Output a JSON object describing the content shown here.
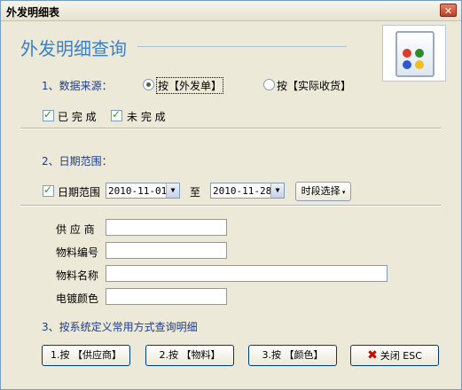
{
  "window": {
    "title": "外发明细表",
    "close_label": "✕"
  },
  "heading": "外发明细查询",
  "logo": {
    "icon": "four-color-squares-icon",
    "colors": [
      "#e23a2a",
      "#2d8a2d",
      "#2a5ad0",
      "#f0c020"
    ]
  },
  "source": {
    "title": "1、数据来源：",
    "options": [
      {
        "label": "按【外发单】",
        "selected": true
      },
      {
        "label": "按【实际收货】",
        "selected": false
      }
    ],
    "checks": [
      {
        "label": "已 完 成",
        "checked": true
      },
      {
        "label": "未 完 成",
        "checked": true
      }
    ]
  },
  "date": {
    "title": "2、日期范围：",
    "check_label": "日期范围",
    "checked": true,
    "from": "2010-11-01",
    "to_label": "至",
    "to": "2010-11-28",
    "period_button": "时段选择"
  },
  "filters": [
    {
      "label": "供 应 商",
      "value": ""
    },
    {
      "label": "物料编号",
      "value": ""
    },
    {
      "label": "物料名称",
      "value": ""
    },
    {
      "label": "电镀颜色",
      "value": ""
    }
  ],
  "query": {
    "title": "3、按系统定义常用方式查询明细",
    "buttons": [
      "1.按 【供应商】",
      "2.按 【物料】",
      "3.按 【颜色】",
      "关闭 ESC"
    ]
  }
}
